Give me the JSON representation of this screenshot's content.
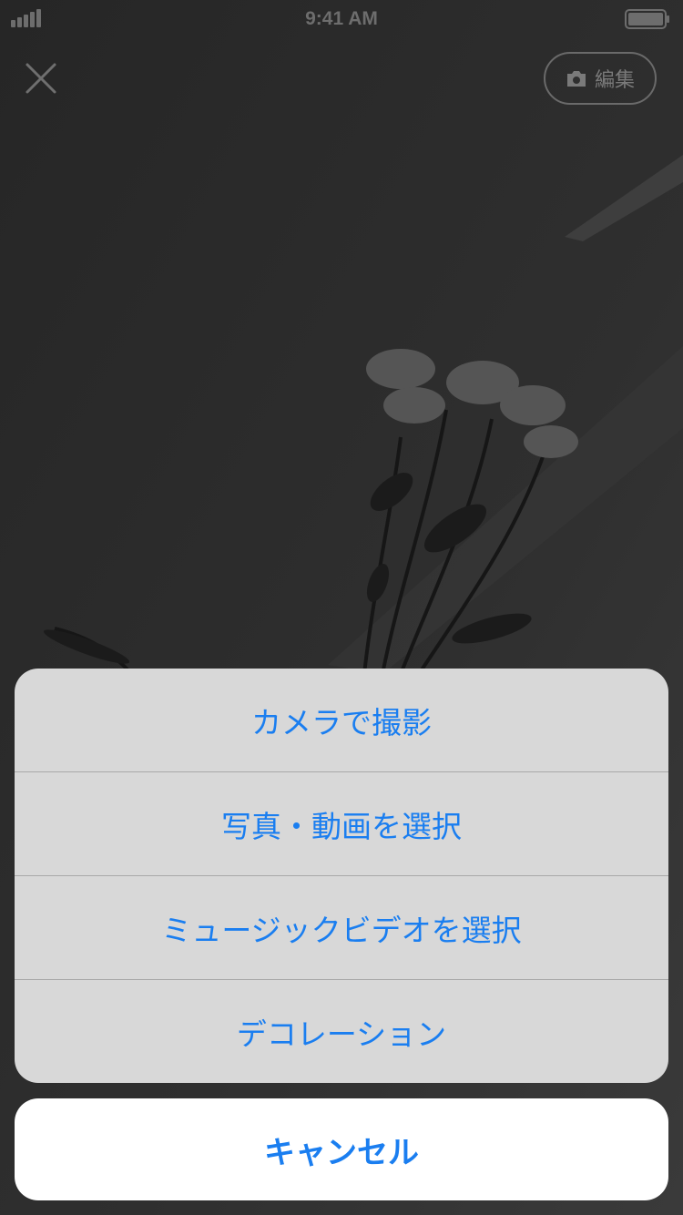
{
  "status_bar": {
    "time": "9:41 AM"
  },
  "header": {
    "close_icon": "close-icon",
    "edit_label": "編集",
    "edit_icon": "camera-icon"
  },
  "action_sheet": {
    "items": [
      {
        "label": "カメラで撮影"
      },
      {
        "label": "写真・動画を選択"
      },
      {
        "label": "ミュージックビデオを選択"
      },
      {
        "label": "デコレーション"
      }
    ],
    "cancel_label": "キャンセル"
  },
  "colors": {
    "accent": "#1a7ef0",
    "sheet_bg": "#d8d8d8",
    "cancel_bg": "#ffffff",
    "dim_bg": "#2b2b2b"
  }
}
